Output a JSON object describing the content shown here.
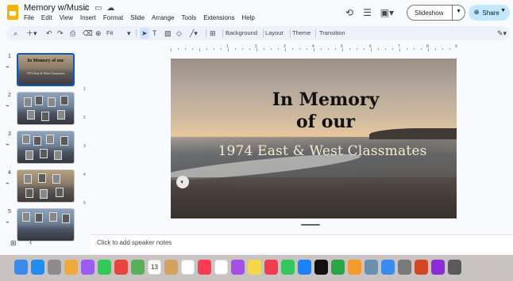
{
  "window": {
    "title": "Memory w/Music",
    "menu": [
      "File",
      "Edit",
      "View",
      "Insert",
      "Format",
      "Slide",
      "Arrange",
      "Tools",
      "Extensions",
      "Help"
    ]
  },
  "header": {
    "slideshow_label": "Slideshow",
    "share_label": "Share"
  },
  "toolbar": {
    "zoom_label": "Fit",
    "background_label": "Background",
    "layout_label": "Layout",
    "theme_label": "Theme",
    "transition_label": "Transition"
  },
  "filmstrip": {
    "slides": [
      {
        "number": "1",
        "title": "In Memory of our",
        "subtitle": "1974 East & West Classmates"
      },
      {
        "number": "2"
      },
      {
        "number": "3"
      },
      {
        "number": "4"
      },
      {
        "number": "5"
      }
    ]
  },
  "ruler": {
    "horizontal": [
      "1",
      "2",
      "3",
      "4",
      "5",
      "6",
      "7",
      "8",
      "9"
    ],
    "vertical": [
      "1",
      "2",
      "3",
      "4",
      "5"
    ]
  },
  "slide": {
    "title_line1": "In Memory",
    "title_line2": "of our",
    "subtitle": "1974 East & West Classmates"
  },
  "notes": {
    "placeholder": "Click to add speaker notes"
  },
  "dock": {
    "calendar_date": "13",
    "apps": [
      {
        "name": "finder",
        "color": "#3d8be8"
      },
      {
        "name": "safari",
        "color": "#1f8ef1"
      },
      {
        "name": "launchpad",
        "color": "#8c8c8c"
      },
      {
        "name": "photos",
        "color": "#f2a93b"
      },
      {
        "name": "messenger",
        "color": "#9b5cf2"
      },
      {
        "name": "messages",
        "color": "#34c759"
      },
      {
        "name": "chrome",
        "color": "#e8453c"
      },
      {
        "name": "maps",
        "color": "#57b15b"
      },
      {
        "name": "calendar",
        "color": "#ffffff"
      },
      {
        "name": "notes-app",
        "color": "#d4a15a"
      },
      {
        "name": "reminders",
        "color": "#ffffff"
      },
      {
        "name": "music",
        "color": "#fa3c55"
      },
      {
        "name": "freeform",
        "color": "#ffffff"
      },
      {
        "name": "podcasts",
        "color": "#a450e6"
      },
      {
        "name": "notes",
        "color": "#f5d74a"
      },
      {
        "name": "news",
        "color": "#f23c4c"
      },
      {
        "name": "facetime",
        "color": "#34c759"
      },
      {
        "name": "app-store",
        "color": "#1a82fb"
      },
      {
        "name": "tv",
        "color": "#111111"
      },
      {
        "name": "numbers",
        "color": "#29a745"
      },
      {
        "name": "pages",
        "color": "#f59b2b"
      },
      {
        "name": "preview",
        "color": "#6b8fb0"
      },
      {
        "name": "mail",
        "color": "#3a8df0"
      },
      {
        "name": "settings",
        "color": "#7a7a7a"
      },
      {
        "name": "powerpoint",
        "color": "#d24726"
      },
      {
        "name": "game",
        "color": "#8b2bd9"
      },
      {
        "name": "app-grid",
        "color": "#5a5a5a"
      }
    ]
  }
}
